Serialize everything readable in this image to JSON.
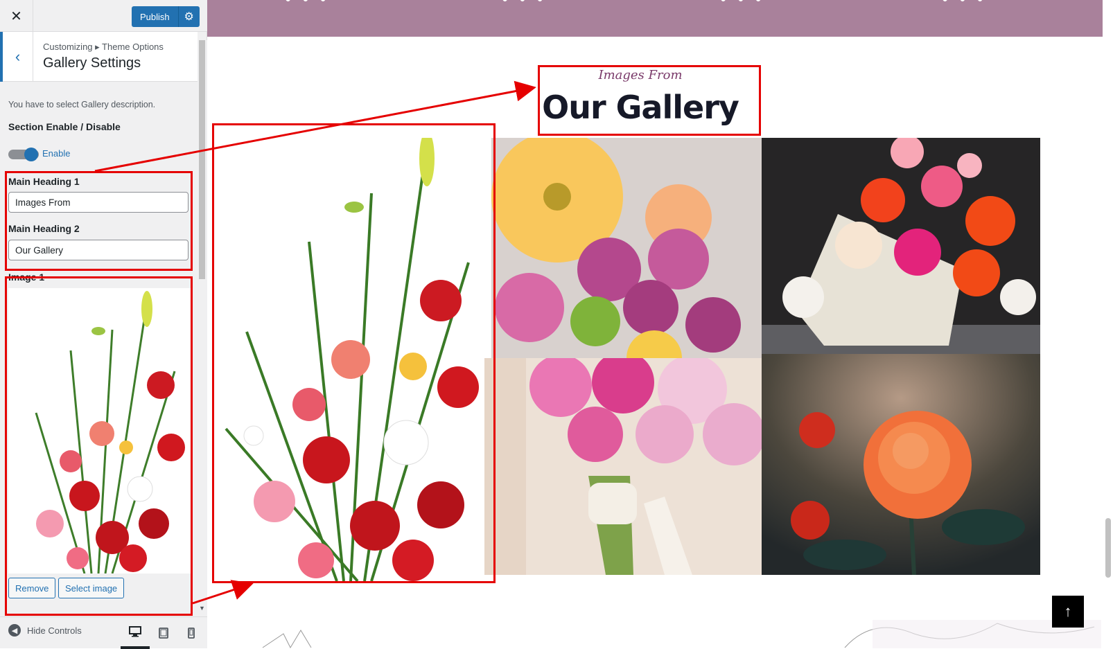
{
  "topbar": {
    "close_icon": "close-icon",
    "publish_label": "Publish",
    "settings_icon": "gear-icon"
  },
  "section": {
    "breadcrumb": "Customizing ▸ Theme Options",
    "title": "Gallery Settings"
  },
  "panel": {
    "description": "You have to select Gallery description.",
    "section_toggle": {
      "title": "Section Enable / Disable",
      "label": "Enable",
      "on": true
    },
    "heading1": {
      "label": "Main Heading 1",
      "value": "Images From"
    },
    "heading2": {
      "label": "Main Heading 2",
      "value": "Our Gallery"
    },
    "image1": {
      "label": "Image 1",
      "remove_label": "Remove",
      "select_label": "Select image"
    }
  },
  "footer": {
    "hide_label": "Hide Controls",
    "devices": [
      "desktop-icon",
      "tablet-icon",
      "mobile-icon"
    ]
  },
  "preview": {
    "subheading": "Images From",
    "heading": "Our Gallery",
    "gallery_images": [
      "floral-arrangement",
      "gerbera-roses-bouquet",
      "roses-in-box",
      "bridal-bouquet",
      "orange-rose"
    ],
    "back_to_top_icon": "arrow-up-icon"
  },
  "colors": {
    "accent": "#2271b1",
    "band": "#a9819b",
    "annotation": "#e50000",
    "heading": "#161928",
    "subheading": "#7a3a6a"
  }
}
